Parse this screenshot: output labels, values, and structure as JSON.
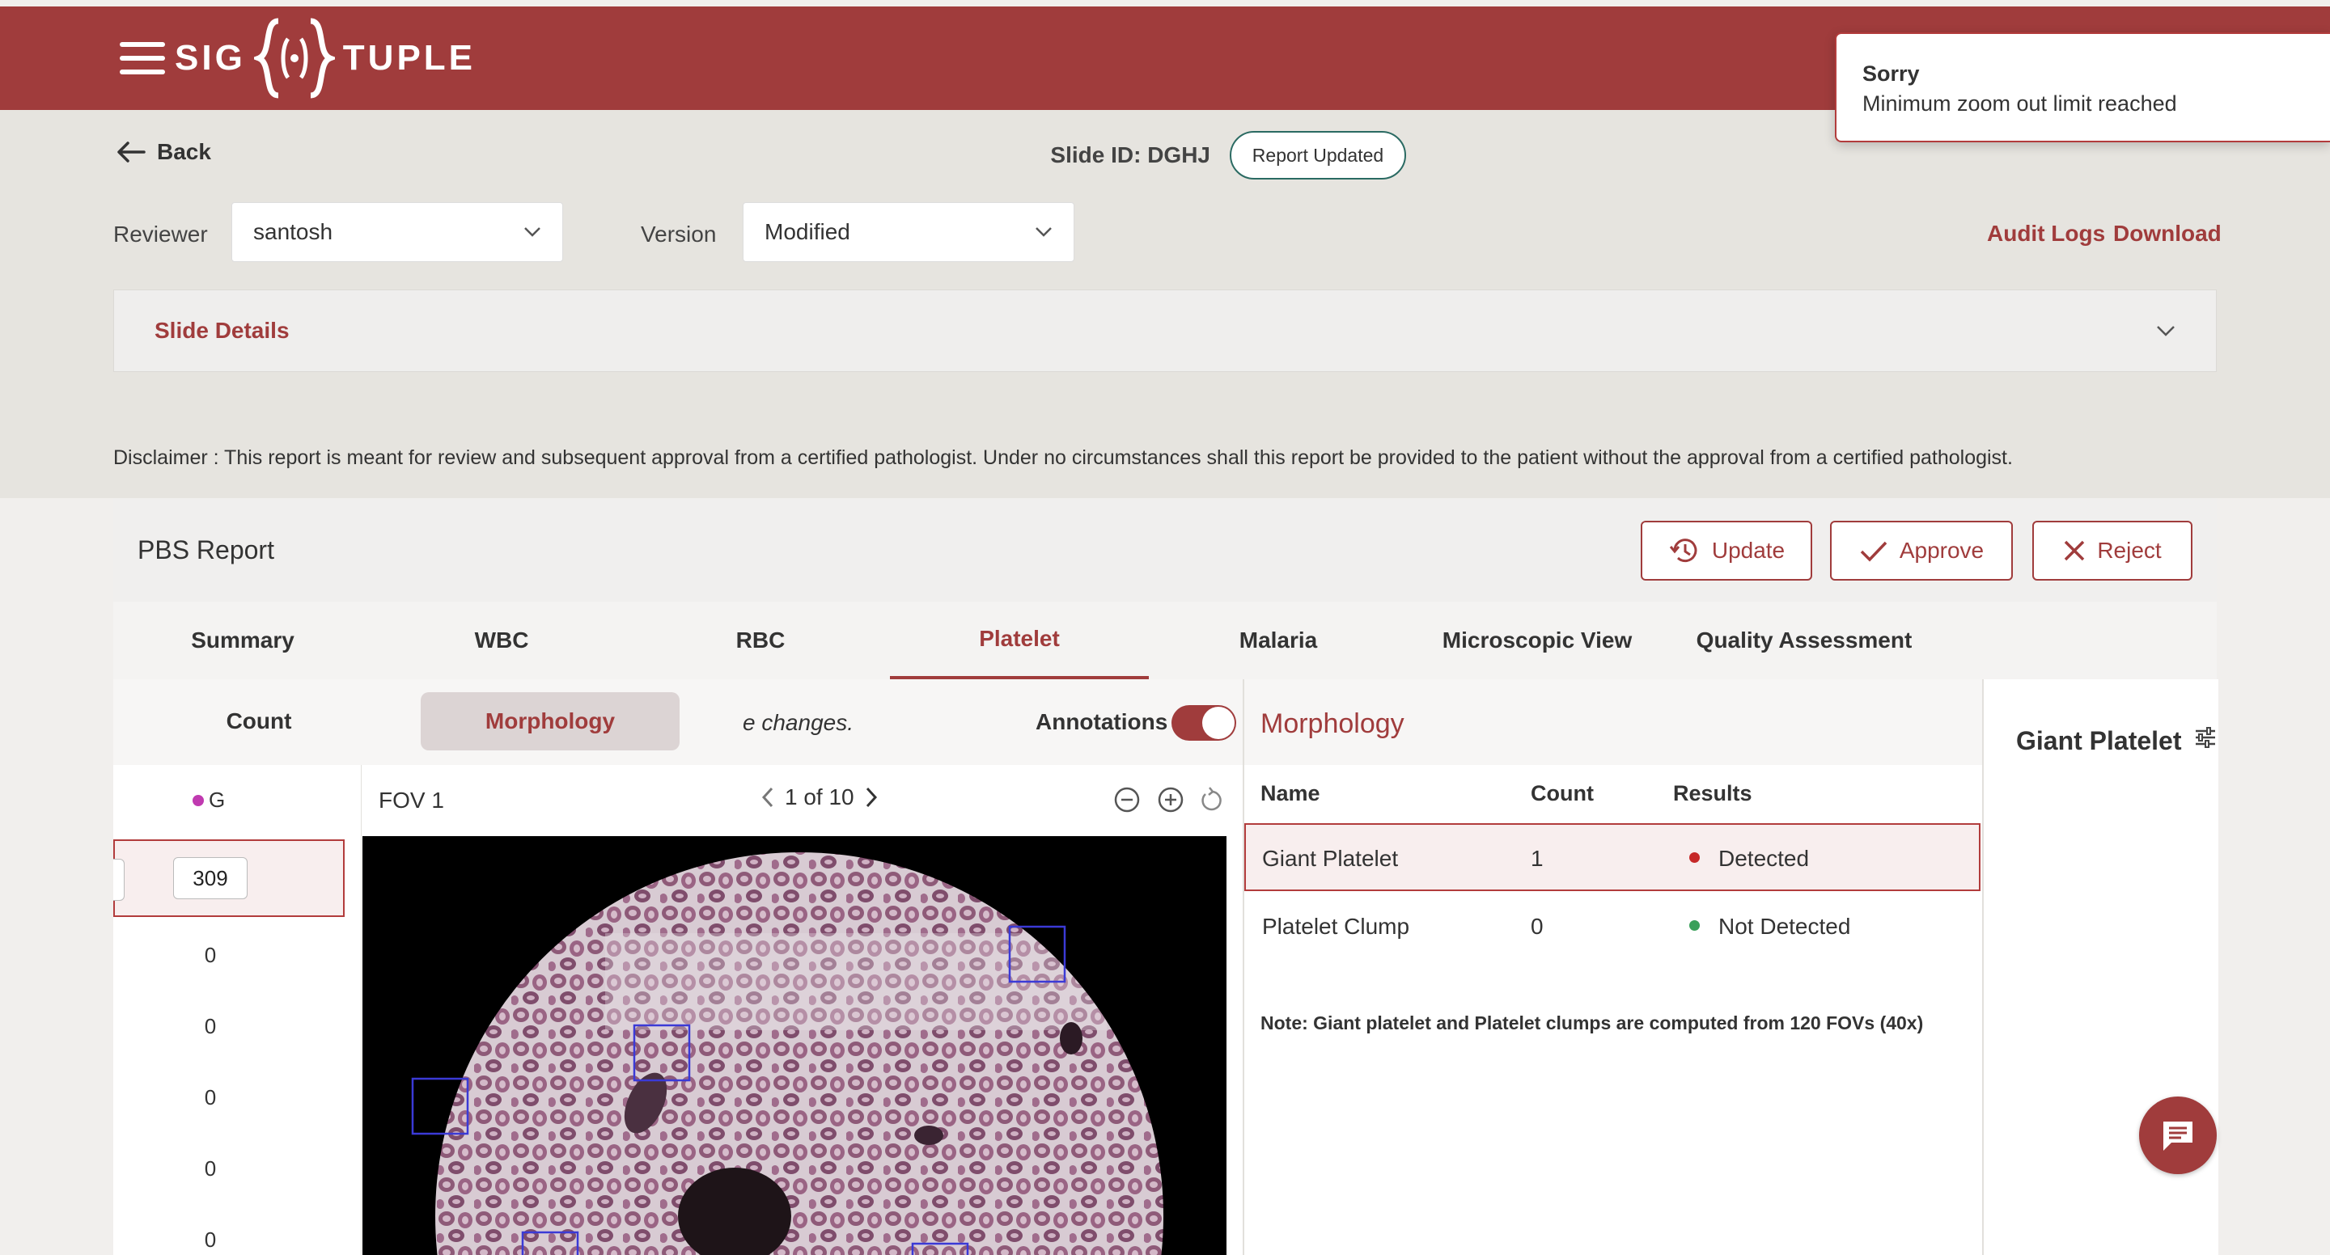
{
  "brand": {
    "logo_left": "SIG",
    "logo_right": "TUPLE",
    "color": "#a03c3c"
  },
  "toast": {
    "title": "Sorry",
    "message": "Minimum zoom out limit reached"
  },
  "nav": {
    "back_label": "Back"
  },
  "slide": {
    "id_label": "Slide ID: DGHJ",
    "status_badge": "Report Updated"
  },
  "filters": {
    "reviewer_label": "Reviewer",
    "reviewer_value": "santosh",
    "version_label": "Version",
    "version_value": "Modified"
  },
  "links": {
    "audit_logs": "Audit Logs",
    "download": "Download"
  },
  "slide_details": {
    "label": "Slide Details"
  },
  "disclaimer": "Disclaimer :  This report is meant for review and subsequent approval from a certified pathologist. Under no circumstances shall this report be provided to the patient without the approval from a certified pathologist.",
  "report": {
    "title": "PBS Report",
    "actions": {
      "update": "Update",
      "approve": "Approve",
      "reject": "Reject"
    },
    "tabs": [
      "Summary",
      "WBC",
      "RBC",
      "Platelet",
      "Malaria",
      "Microscopic View",
      "Quality Assessment"
    ],
    "active_tab": "Platelet"
  },
  "subtabs": {
    "count": "Count",
    "morphology": "Morphology",
    "active": "Morphology"
  },
  "changes_text": "e changes.",
  "annotations": {
    "label": "Annotations",
    "enabled": true
  },
  "count_column": {
    "legend": "G",
    "legend_color": "#c03ab0",
    "highlighted_value": "309",
    "values": [
      "0",
      "0",
      "0",
      "0",
      "0"
    ]
  },
  "viewer": {
    "fov_label": "FOV 1",
    "pager": "1 of 10"
  },
  "morphology": {
    "title": "Morphology",
    "headers": {
      "name": "Name",
      "count": "Count",
      "results": "Results"
    },
    "rows": [
      {
        "name": "Giant Platelet",
        "count": "1",
        "result": "Detected",
        "dot_color": "#c62828",
        "selected": true
      },
      {
        "name": "Platelet Clump",
        "count": "0",
        "result": "Not Detected",
        "dot_color": "#3aa05a",
        "selected": false
      }
    ],
    "note": "Note: Giant platelet and Platelet clumps are computed from 120 FOVs (40x)"
  },
  "right_panel": {
    "title": "Giant Platelet"
  },
  "icons": [
    "menu-icon",
    "arrow-left-icon",
    "chevron-down-icon",
    "history-icon",
    "check-icon",
    "close-icon",
    "chevron-left-icon",
    "chevron-right-icon",
    "zoom-out-icon",
    "zoom-in-icon",
    "reset-icon",
    "filter-icon",
    "chat-icon"
  ]
}
